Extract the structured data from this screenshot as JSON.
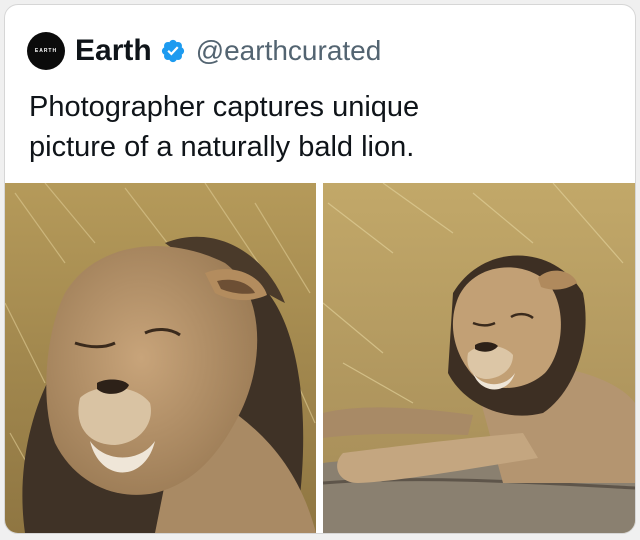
{
  "tweet": {
    "author": {
      "avatar_text": "EARTH",
      "display_name": "Earth",
      "handle": "@earthcurated",
      "verified_icon": "verified-badge-icon"
    },
    "text_lines": [
      "Photographer captures unique",
      "picture of a naturally bald lion."
    ],
    "colors": {
      "verified": "#1d9bf0",
      "text": "#0f1419",
      "handle": "#536471"
    },
    "media": [
      {
        "description_name": "lion-closeup-photo"
      },
      {
        "description_name": "lion-lying-photo"
      }
    ]
  }
}
